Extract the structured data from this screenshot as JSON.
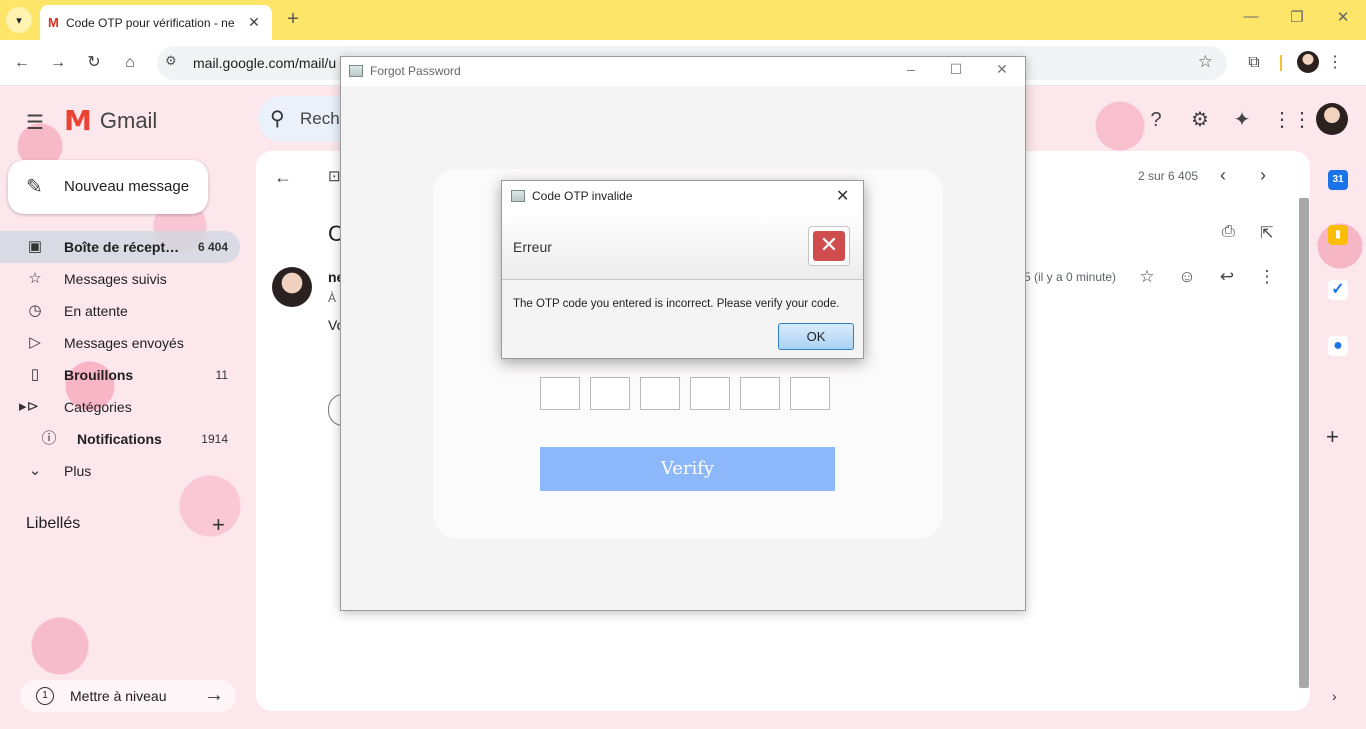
{
  "browser": {
    "tab_title": "Code OTP pour vérification - ne",
    "url": "mail.google.com/mail/u",
    "favicon": "M"
  },
  "gmail": {
    "brand": "Gmail",
    "search_placeholder": "Reche",
    "compose_label": "Nouveau message",
    "nav": [
      {
        "label": "Boîte de récept…",
        "count": "6 404",
        "icon": "inbox-icon",
        "active": true,
        "bold": true
      },
      {
        "label": "Messages suivis",
        "count": "",
        "icon": "star-icon"
      },
      {
        "label": "En attente",
        "count": "",
        "icon": "clock-icon"
      },
      {
        "label": "Messages envoyés",
        "count": "",
        "icon": "send-icon"
      },
      {
        "label": "Brouillons",
        "count": "11",
        "icon": "draft-icon",
        "bold": true
      },
      {
        "label": "Catégories",
        "count": "",
        "icon": "label-icon"
      },
      {
        "label": "Notifications",
        "count": "1914",
        "icon": "info-icon",
        "bold": true
      },
      {
        "label": "Plus",
        "count": "",
        "icon": "chevron-down-icon"
      }
    ],
    "labels_heading": "Libellés",
    "upgrade_label": "Mettre à niveau",
    "message": {
      "pager": "2 sur 6 405",
      "subject_initial": "C",
      "sender_initial": "ne",
      "to_initial": "À n",
      "time": "5 (il y a 0 minute)",
      "body_initial": "Vo"
    }
  },
  "forgot_window": {
    "title": "Forgot Password",
    "otp_boxes": [
      "",
      "",
      "",
      "",
      "",
      ""
    ],
    "verify_label": "Verify"
  },
  "dialog": {
    "title": "Code OTP invalide",
    "header": "Erreur",
    "message": "The OTP code you entered is incorrect. Please verify your code.",
    "ok_label": "OK"
  },
  "colors": {
    "tabstrip": "#fde56a",
    "verify_button": "#8db7fb",
    "error_icon": "#cf4d4d"
  }
}
